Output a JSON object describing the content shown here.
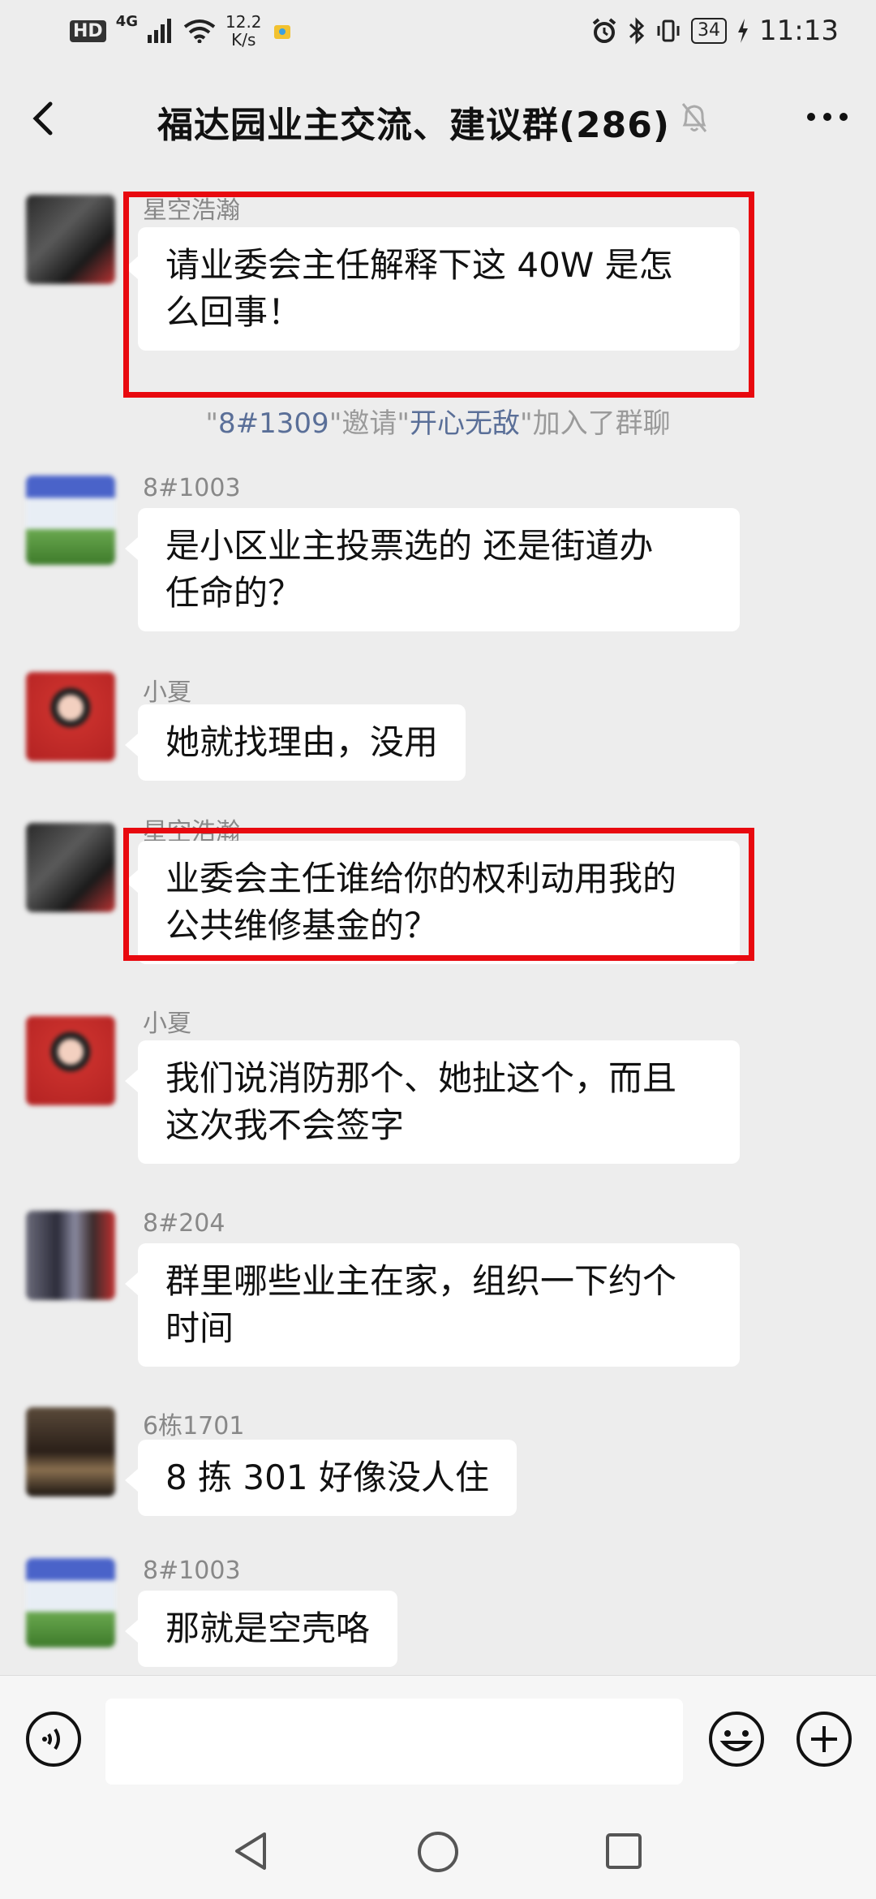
{
  "status_bar": {
    "hd": "HD",
    "network": "4G",
    "speed_value": "12.2",
    "speed_unit": "K/s",
    "battery": "34",
    "time": "11:13"
  },
  "header": {
    "title": "福达园业主交流、建议群(286)"
  },
  "messages": [
    {
      "sender": "星空浩瀚",
      "lines": [
        "请业委会主任解释下这 40W 是怎",
        "么回事！"
      ]
    },
    {
      "sender": "8#1003",
      "lines": [
        "是小区业主投票选的 还是街道办",
        "任命的？"
      ]
    },
    {
      "sender": "小夏",
      "lines": [
        "她就找理由，没用"
      ]
    },
    {
      "sender": "星空浩瀚",
      "lines": [
        "业委会主任谁给你的权利动用我的",
        "公共维修基金的？"
      ]
    },
    {
      "sender": "小夏",
      "lines": [
        "我们说消防那个、她扯这个，而且",
        "这次我不会签字"
      ]
    },
    {
      "sender": "8#204",
      "lines": [
        "群里哪些业主在家，组织一下约个",
        "时间"
      ]
    },
    {
      "sender": "6栋1701",
      "lines": [
        "8 拣 301 好像没人住"
      ]
    },
    {
      "sender": "8#1003",
      "lines": [
        "那就是空壳咯"
      ]
    }
  ],
  "system_message": {
    "quote_open": "\"",
    "inviter": "8#1309",
    "quote_mid1": "\"邀请\"",
    "invitee": "开心无敌",
    "quote_close": "\"",
    "suffix": "加入了群聊"
  },
  "input": {
    "value": "",
    "placeholder": ""
  },
  "colors": {
    "background": "#ededed",
    "bubble": "#ffffff",
    "highlight": "#e8090f",
    "system_name": "#5a6f98"
  }
}
